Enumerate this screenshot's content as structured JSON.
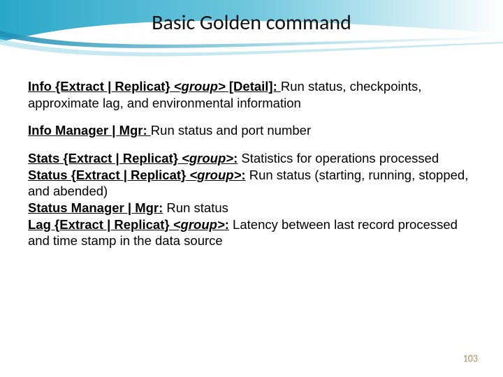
{
  "title": "Basic Golden command",
  "items": [
    {
      "cmd_pre": "Info {Extract | Replicat}",
      "cmd_group": " <group>",
      "cmd_post": " [Detail]:",
      "desc": " Run status, checkpoints, approximate lag, and environmental information"
    },
    {
      "cmd_pre": "Info Manager | Mgr:",
      "cmd_group": "",
      "cmd_post": "",
      "desc": " Run status and port number"
    },
    {
      "lines": [
        {
          "cmd_pre": "Stats {Extract | Replicat}",
          "cmd_group": " <group>",
          "cmd_post": ":",
          "desc": " Statistics for operations processed"
        },
        {
          "cmd_pre": "Status {Extract | Replicat}",
          "cmd_group": " <group>",
          "cmd_post": ":",
          "desc": " Run status (starting, running, stopped, and abended)"
        },
        {
          "cmd_pre": "Status Manager | Mgr:",
          "cmd_group": "",
          "cmd_post": "",
          "desc": " Run status"
        },
        {
          "cmd_pre": "Lag {Extract | Replicat}",
          "cmd_group": " <group>",
          "cmd_post": ":",
          "desc": " Latency between last record processed and time stamp in the data source"
        }
      ]
    }
  ],
  "page_number": "103"
}
